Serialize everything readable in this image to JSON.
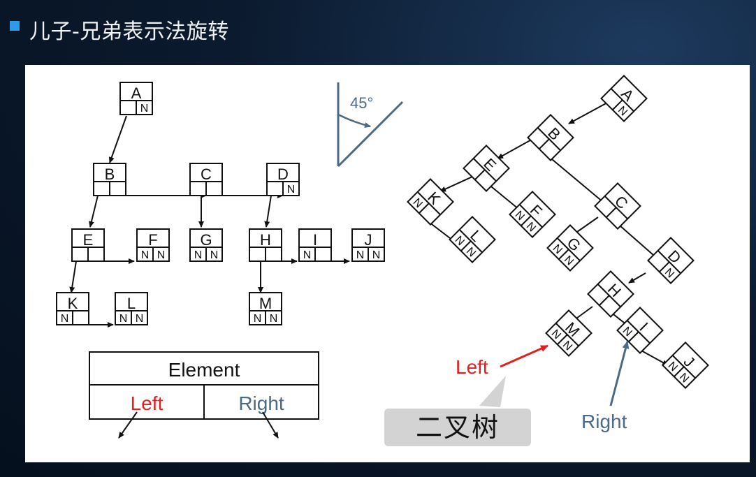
{
  "title": "儿子-兄弟表示法旋转",
  "angle_label": "45°",
  "legend": {
    "element": "Element",
    "left": "Left",
    "right": "Right"
  },
  "annotations": {
    "left": "Left",
    "right": "Right"
  },
  "bubble": "二叉树",
  "null_mark": "N",
  "colors": {
    "left": "#e02020",
    "right": "#4a6a88",
    "title_bullet": "#2f9be5"
  },
  "nodes": [
    "A",
    "B",
    "C",
    "D",
    "E",
    "F",
    "G",
    "H",
    "I",
    "J",
    "K",
    "L",
    "M"
  ]
}
